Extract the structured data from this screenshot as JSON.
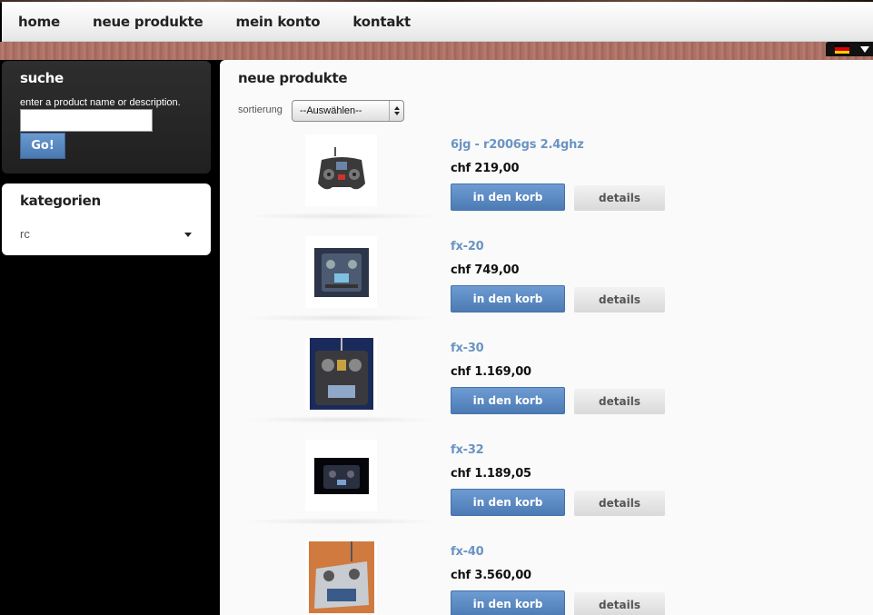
{
  "nav": {
    "items": [
      "home",
      "neue produkte",
      "mein konto",
      "kontakt"
    ]
  },
  "language": {
    "flag": "german-flag",
    "flag_colors": [
      "#000000",
      "#dd0000",
      "#ffce00"
    ]
  },
  "search": {
    "title": "suche",
    "hint": "enter a product name or description.",
    "input_value": "",
    "button_label": "Go!"
  },
  "categories": {
    "title": "kategorien",
    "selected": "rc"
  },
  "main": {
    "title": "neue produkte",
    "sort_label": "sortierung",
    "sort_selected": "--Auswählen--"
  },
  "products": [
    {
      "name": "6jg - r2006gs 2.4ghz",
      "price": "chf 219,00",
      "cart_label": "in den korb",
      "details_label": "details",
      "image": "rc-transmitter-icon"
    },
    {
      "name": "fx-20",
      "price": "chf 749,00",
      "cart_label": "in den korb",
      "details_label": "details",
      "image": "rc-transmitter-icon"
    },
    {
      "name": "fx-30",
      "price": "chf 1.169,00",
      "cart_label": "in den korb",
      "details_label": "details",
      "image": "rc-transmitter-icon"
    },
    {
      "name": "fx-32",
      "price": "chf 1.189,05",
      "cart_label": "in den korb",
      "details_label": "details",
      "image": "rc-transmitter-icon"
    },
    {
      "name": "fx-40",
      "price": "chf 3.560,00",
      "cart_label": "in den korb",
      "details_label": "details",
      "image": "rc-transmitter-icon"
    }
  ],
  "colors": {
    "accent": "#5b89c2",
    "link": "#6a94c4",
    "panel": "#fafafa"
  }
}
